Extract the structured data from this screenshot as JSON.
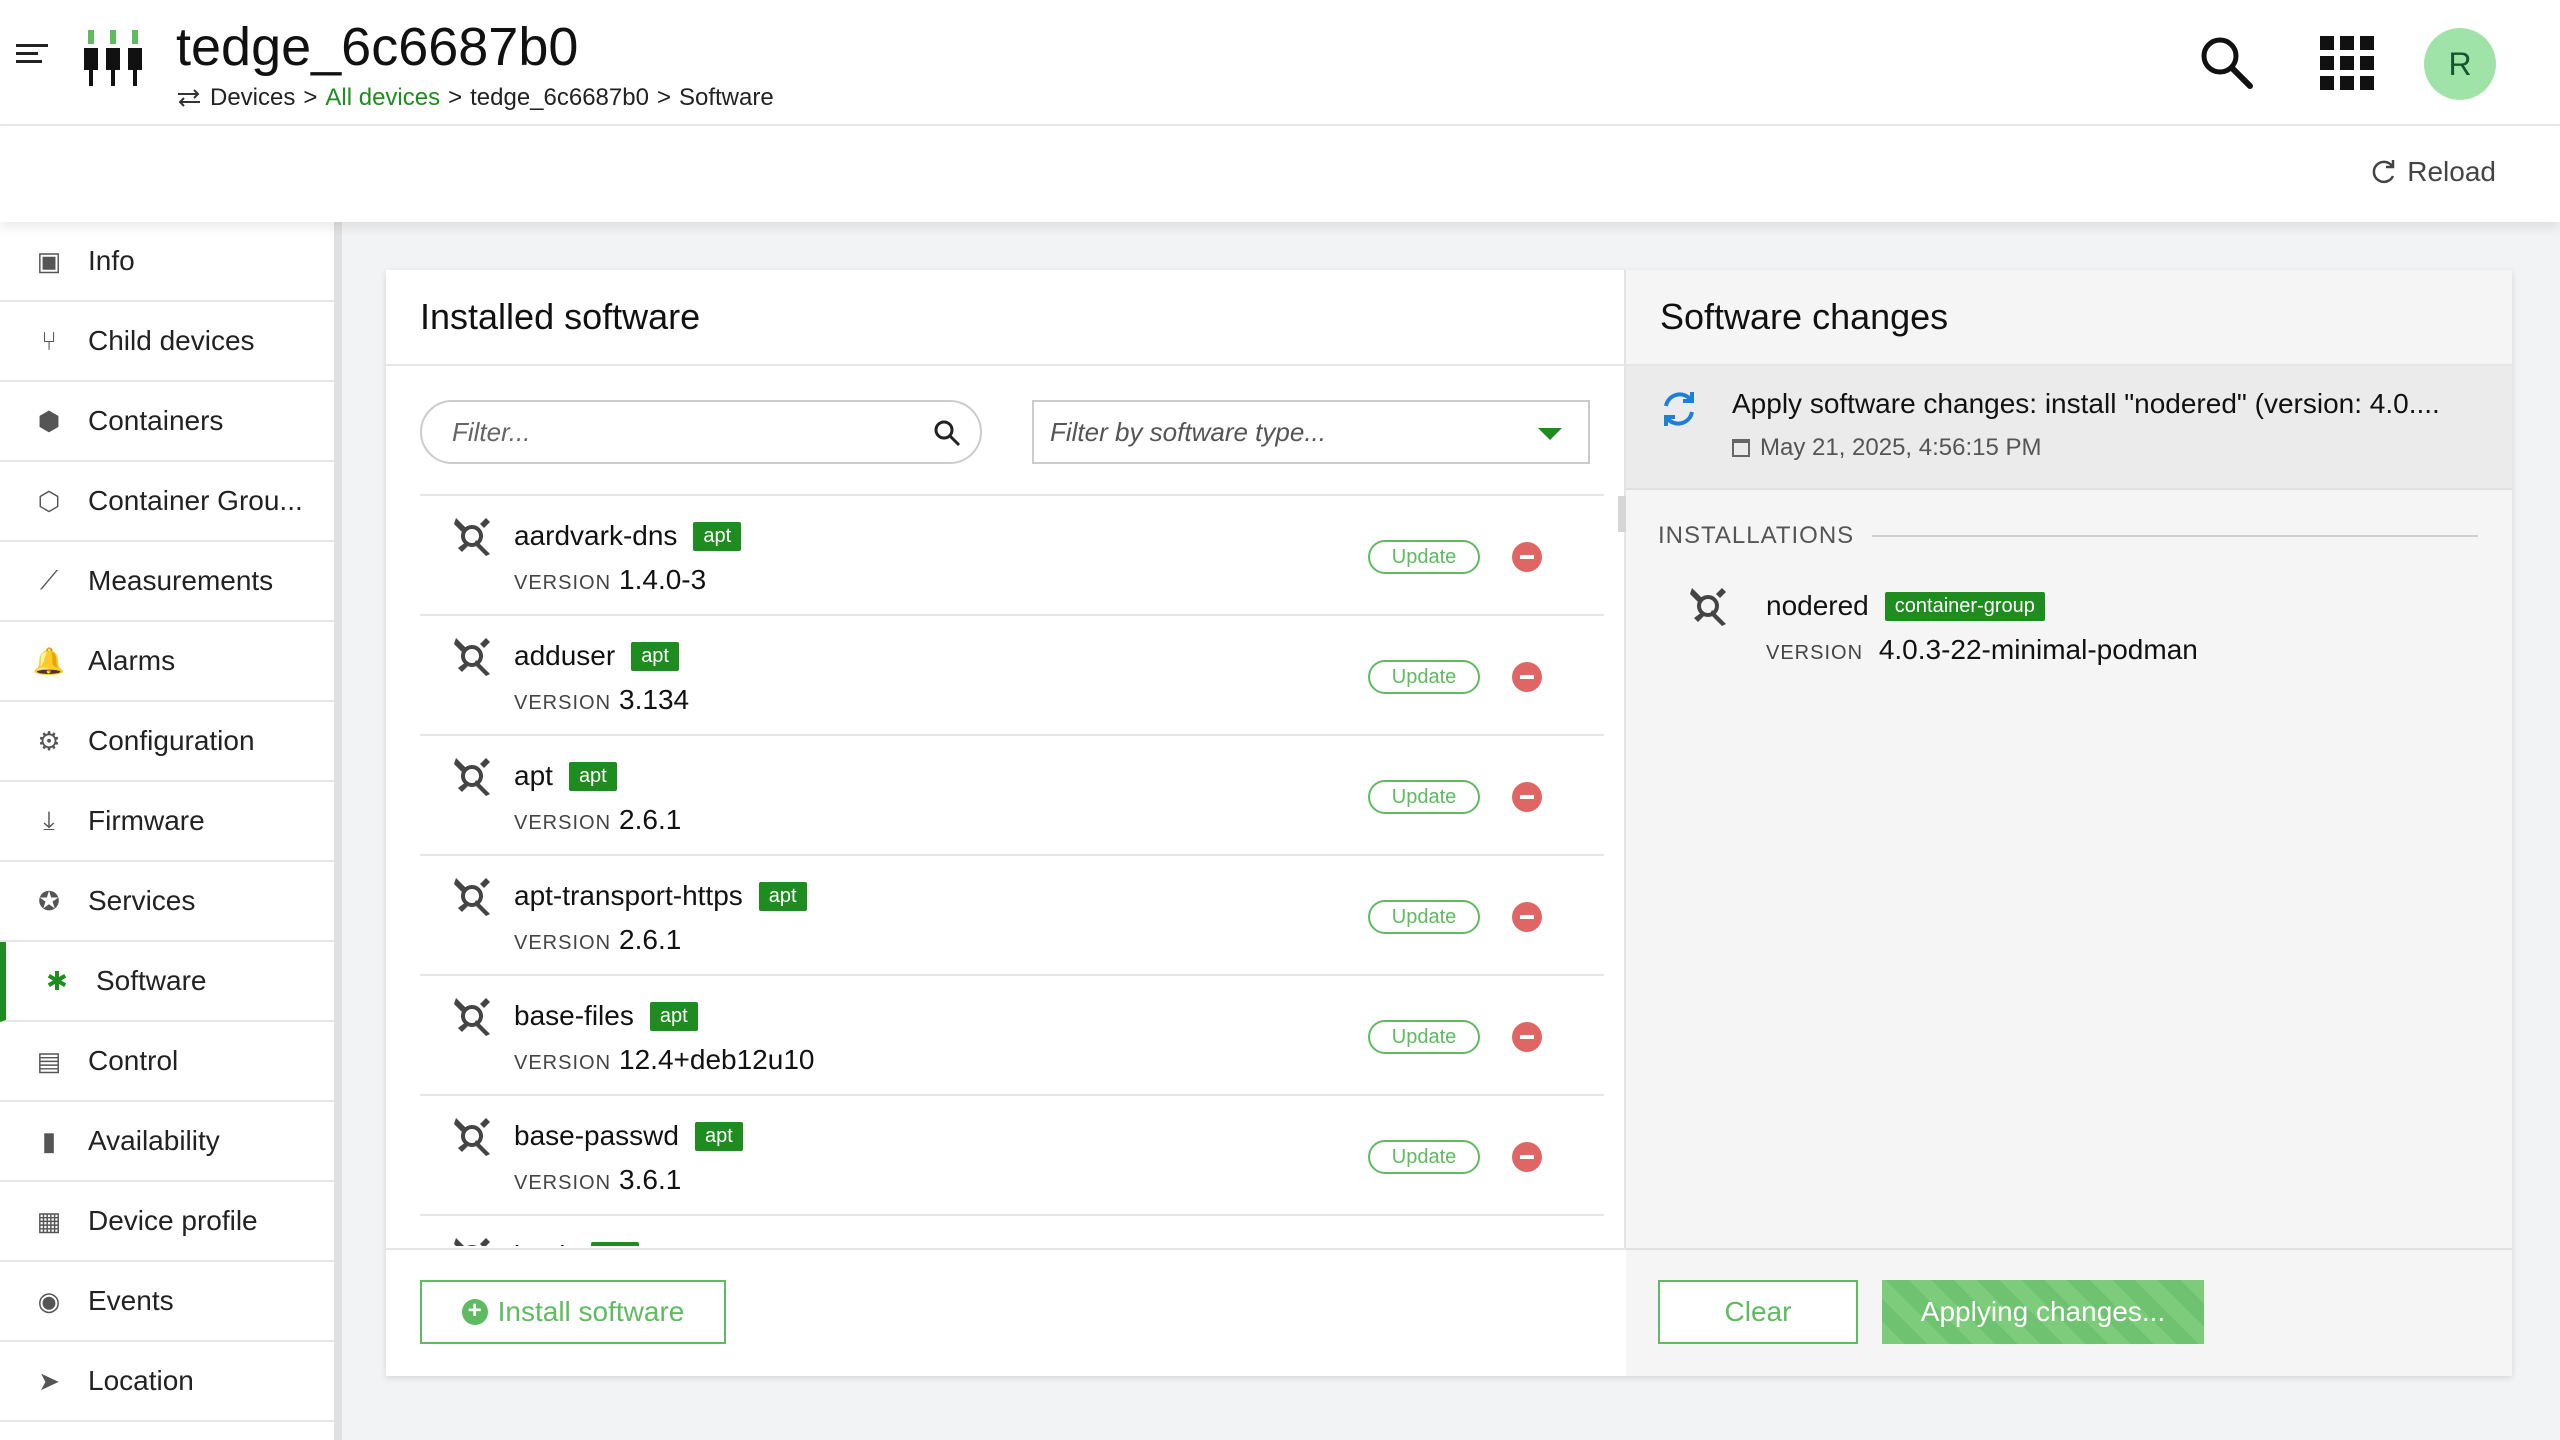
{
  "header": {
    "title": "tedge_6c6687b0",
    "breadcrumb": [
      "Devices",
      "All devices",
      "tedge_6c6687b0",
      "Software"
    ],
    "breadcrumb_separator": ">",
    "avatar_initial": "R",
    "icons": {
      "menu": "menu-toggle-icon",
      "device": "device-icon",
      "search": "search-icon",
      "apps": "app-switcher-icon"
    }
  },
  "actionbar": {
    "reload_label": "Reload"
  },
  "sidebar": {
    "items": [
      {
        "label": "Info",
        "icon": "info-icon",
        "glyph": "▣"
      },
      {
        "label": "Child devices",
        "icon": "child-devices-icon",
        "glyph": "⑂"
      },
      {
        "label": "Containers",
        "icon": "container-icon",
        "glyph": "⬢"
      },
      {
        "label": "Container Grou...",
        "icon": "container-group-icon",
        "glyph": "⬡"
      },
      {
        "label": "Measurements",
        "icon": "chart-icon",
        "glyph": "⟋"
      },
      {
        "label": "Alarms",
        "icon": "bell-icon",
        "glyph": "🔔"
      },
      {
        "label": "Configuration",
        "icon": "gears-icon",
        "glyph": "⚙"
      },
      {
        "label": "Firmware",
        "icon": "firmware-icon",
        "glyph": "⤓"
      },
      {
        "label": "Services",
        "icon": "services-icon",
        "glyph": "✪"
      },
      {
        "label": "Software",
        "icon": "software-icon",
        "glyph": "✱"
      },
      {
        "label": "Control",
        "icon": "control-icon",
        "glyph": "▤"
      },
      {
        "label": "Availability",
        "icon": "availability-icon",
        "glyph": "▮"
      },
      {
        "label": "Device profile",
        "icon": "device-profile-icon",
        "glyph": "▦"
      },
      {
        "label": "Events",
        "icon": "events-icon",
        "glyph": "◉"
      },
      {
        "label": "Location",
        "icon": "location-icon",
        "glyph": "➤"
      }
    ],
    "active": "Software"
  },
  "installed": {
    "title": "Installed software",
    "filter_placeholder": "Filter...",
    "type_placeholder": "Filter by software type...",
    "version_label": "VERSION",
    "update_label": "Update",
    "items": [
      {
        "name": "aardvark-dns",
        "type": "apt",
        "version": "1.4.0-3"
      },
      {
        "name": "adduser",
        "type": "apt",
        "version": "3.134"
      },
      {
        "name": "apt",
        "type": "apt",
        "version": "2.6.1"
      },
      {
        "name": "apt-transport-https",
        "type": "apt",
        "version": "2.6.1"
      },
      {
        "name": "base-files",
        "type": "apt",
        "version": "12.4+deb12u10"
      },
      {
        "name": "base-passwd",
        "type": "apt",
        "version": "3.6.1"
      },
      {
        "name": "bash",
        "type": "apt",
        "version": ""
      }
    ],
    "install_label": "Install software"
  },
  "changes": {
    "title": "Software changes",
    "operation_text": "Apply software changes: install \"nodered\" (version: 4.0....",
    "operation_date": "May 21, 2025, 4:56:15 PM",
    "installations_heading": "INSTALLATIONS",
    "version_label": "VERSION",
    "installation": {
      "name": "nodered",
      "type": "container-group",
      "version": "4.0.3-22-minimal-podman"
    },
    "clear_label": "Clear",
    "apply_label": "Applying changes..."
  },
  "colors": {
    "accent": "#1e8c1e",
    "light_accent": "#5fbb5f",
    "danger": "#e06666",
    "avatar_bg": "#9fe3a8"
  }
}
